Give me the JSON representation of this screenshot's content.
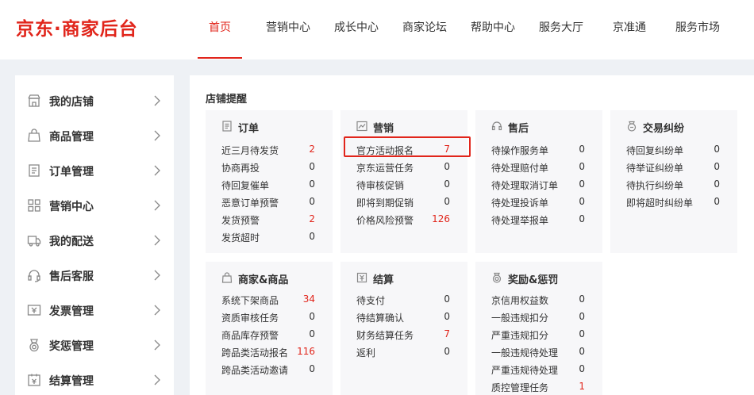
{
  "brand": {
    "logo_text": "京东·商家后台",
    "accent": "#e1251b"
  },
  "nav": {
    "items": [
      "首页",
      "营销中心",
      "成长中心",
      "商家论坛",
      "帮助中心",
      "服务大厅",
      "京准通",
      "服务市场"
    ],
    "active": "首页"
  },
  "sidebar": {
    "items": [
      {
        "label": "我的店铺",
        "icon": "store-icon"
      },
      {
        "label": "商品管理",
        "icon": "bag-icon"
      },
      {
        "label": "订单管理",
        "icon": "document-icon"
      },
      {
        "label": "营销中心",
        "icon": "grid-icon"
      },
      {
        "label": "我的配送",
        "icon": "truck-icon"
      },
      {
        "label": "售后客服",
        "icon": "headset-icon"
      },
      {
        "label": "发票管理",
        "icon": "invoice-icon"
      },
      {
        "label": "奖惩管理",
        "icon": "medal-icon"
      },
      {
        "label": "结算管理",
        "icon": "calendar-icon"
      }
    ]
  },
  "main": {
    "title": "店铺提醒",
    "cards": [
      {
        "title": "订单",
        "icon": "document-icon",
        "rows": [
          {
            "label": "近三月待发货",
            "value": "2",
            "red": true
          },
          {
            "label": "协商再投",
            "value": "0",
            "red": false
          },
          {
            "label": "待回复催单",
            "value": "0",
            "red": false
          },
          {
            "label": "恶意订单预警",
            "value": "0",
            "red": false
          },
          {
            "label": "发货预警",
            "value": "2",
            "red": true
          },
          {
            "label": "发货超时",
            "value": "0",
            "red": false
          }
        ]
      },
      {
        "title": "营销",
        "icon": "chart-icon",
        "rows": [
          {
            "label": "官方活动报名",
            "value": "7",
            "red": true
          },
          {
            "label": "京东运营任务",
            "value": "0",
            "red": false
          },
          {
            "label": "待审核促销",
            "value": "0",
            "red": false
          },
          {
            "label": "即将到期促销",
            "value": "0",
            "red": false
          },
          {
            "label": "价格风险预警",
            "value": "126",
            "red": true
          }
        ]
      },
      {
        "title": "售后",
        "icon": "headset-icon",
        "rows": [
          {
            "label": "待操作服务单",
            "value": "0",
            "red": false
          },
          {
            "label": "待处理赔付单",
            "value": "0",
            "red": false
          },
          {
            "label": "待处理取消订单",
            "value": "0",
            "red": false
          },
          {
            "label": "待处理投诉单",
            "value": "0",
            "red": false
          },
          {
            "label": "待处理举报单",
            "value": "0",
            "red": false
          }
        ]
      },
      {
        "title": "交易纠纷",
        "icon": "dispute-icon",
        "rows": [
          {
            "label": "待回复纠纷单",
            "value": "0",
            "red": false
          },
          {
            "label": "待举证纠纷单",
            "value": "0",
            "red": false
          },
          {
            "label": "待执行纠纷单",
            "value": "0",
            "red": false
          },
          {
            "label": "即将超时纠纷单",
            "value": "0",
            "red": false
          }
        ]
      },
      {
        "title": "商家&商品",
        "icon": "bag-icon",
        "rows": [
          {
            "label": "系统下架商品",
            "value": "34",
            "red": true
          },
          {
            "label": "资质审核任务",
            "value": "0",
            "red": false
          },
          {
            "label": "商品库存预警",
            "value": "0",
            "red": false
          },
          {
            "label": "跨品类活动报名",
            "value": "116",
            "red": true
          },
          {
            "label": "跨品类活动邀请",
            "value": "0",
            "red": false
          }
        ]
      },
      {
        "title": "结算",
        "icon": "settlement-icon",
        "rows": [
          {
            "label": "待支付",
            "value": "0",
            "red": false
          },
          {
            "label": "待结算确认",
            "value": "0",
            "red": false
          },
          {
            "label": "财务结算任务",
            "value": "7",
            "red": true
          },
          {
            "label": "返利",
            "value": "0",
            "red": false
          }
        ]
      },
      {
        "title": "奖励&惩罚",
        "icon": "medal-icon",
        "rows": [
          {
            "label": "京信用权益数",
            "value": "0",
            "red": false
          },
          {
            "label": "一般违规扣分",
            "value": "0",
            "red": false
          },
          {
            "label": "严重违规扣分",
            "value": "0",
            "red": false
          },
          {
            "label": "一般违规待处理",
            "value": "0",
            "red": false
          },
          {
            "label": "严重违规待处理",
            "value": "0",
            "red": false
          },
          {
            "label": "质控管理任务",
            "value": "1",
            "red": true
          }
        ]
      }
    ]
  }
}
